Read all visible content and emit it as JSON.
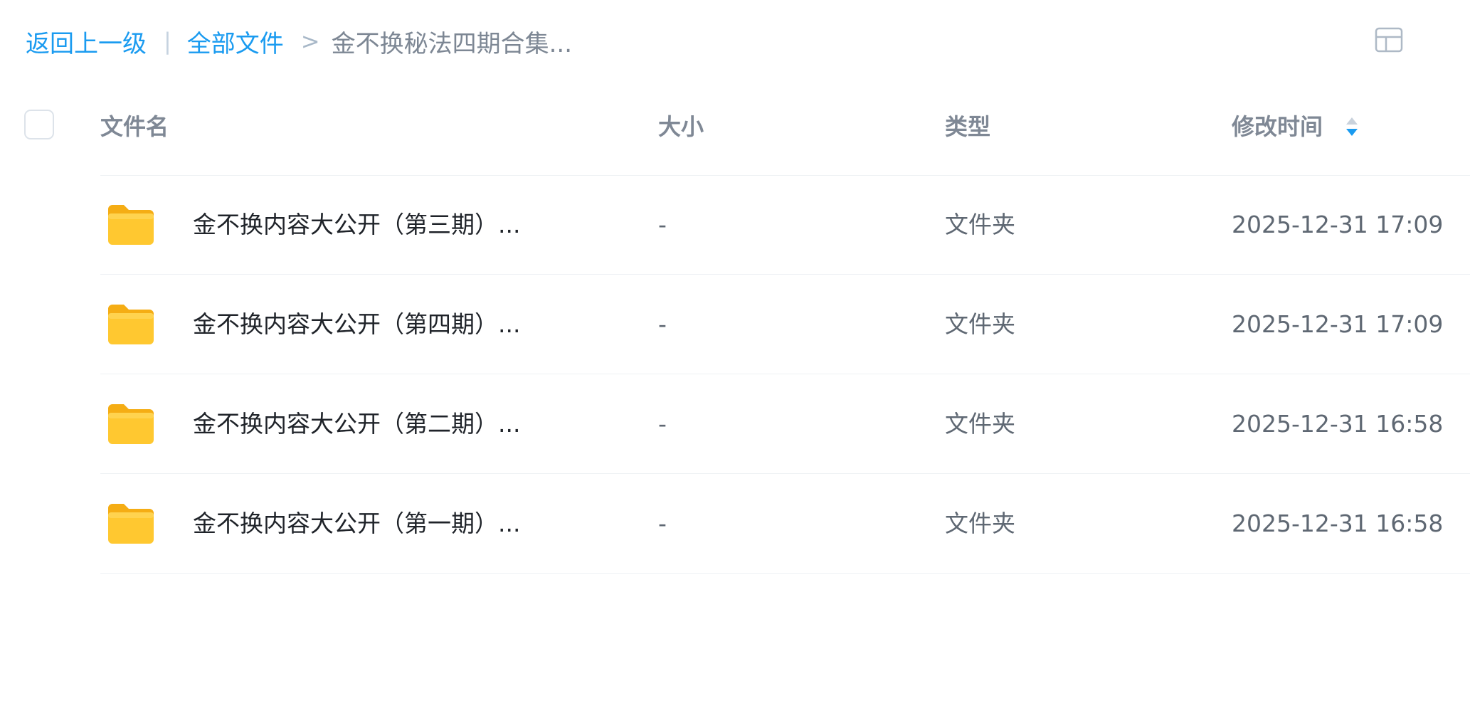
{
  "breadcrumb": {
    "back": "返回上一级",
    "separator_bar": "|",
    "root": "全部文件",
    "separator_arrow": ">",
    "current": "金不换秘法四期合集..."
  },
  "header": {
    "name": "文件名",
    "size": "大小",
    "type": "类型",
    "modified": "修改时间"
  },
  "files": [
    {
      "name": "金不换内容大公开（第三期）...",
      "size": "-",
      "type": "文件夹",
      "modified": "2025-12-31 17:09"
    },
    {
      "name": "金不换内容大公开（第四期）...",
      "size": "-",
      "type": "文件夹",
      "modified": "2025-12-31 17:09"
    },
    {
      "name": "金不换内容大公开（第二期）...",
      "size": "-",
      "type": "文件夹",
      "modified": "2025-12-31 16:58"
    },
    {
      "name": "金不换内容大公开（第一期）...",
      "size": "-",
      "type": "文件夹",
      "modified": "2025-12-31 16:58"
    }
  ],
  "icons": {
    "view_toggle": "grid-view-icon",
    "sort": "sort-icon",
    "folder": "folder-icon"
  },
  "colors": {
    "link": "#1a9bf0",
    "folder": "#ffc42e",
    "sort_active": "#1a9bf0"
  }
}
